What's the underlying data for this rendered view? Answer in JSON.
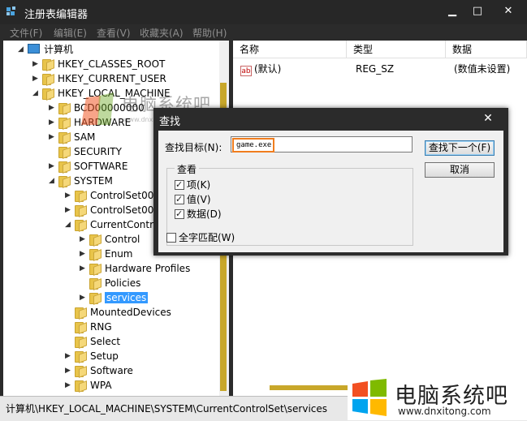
{
  "window": {
    "title": "注册表编辑器",
    "controls": {
      "minimize": "▁",
      "maximize": "□",
      "close": "✕"
    }
  },
  "menu": [
    "文件(F)",
    "编辑(E)",
    "查看(V)",
    "收藏夹(A)",
    "帮助(H)"
  ],
  "tree": {
    "root": "计算机",
    "nodes": [
      {
        "label": "HKEY_CLASSES_ROOT",
        "level": 1,
        "expander": "▶"
      },
      {
        "label": "HKEY_CURRENT_USER",
        "level": 1,
        "expander": "▶"
      },
      {
        "label": "HKEY_LOCAL_MACHINE",
        "level": 1,
        "expander": "◢"
      },
      {
        "label": "BCD00000000",
        "level": 2,
        "expander": "▶"
      },
      {
        "label": "HARDWARE",
        "level": 2,
        "expander": "▶"
      },
      {
        "label": "SAM",
        "level": 2,
        "expander": "▶"
      },
      {
        "label": "SECURITY",
        "level": 2,
        "expander": ""
      },
      {
        "label": "SOFTWARE",
        "level": 2,
        "expander": "▶"
      },
      {
        "label": "SYSTEM",
        "level": 2,
        "expander": "◢"
      },
      {
        "label": "ControlSet001",
        "level": 3,
        "expander": "▶"
      },
      {
        "label": "ControlSet002",
        "level": 3,
        "expander": "▶"
      },
      {
        "label": "CurrentControlSet",
        "level": 3,
        "expander": "◢"
      },
      {
        "label": "Control",
        "level": 4,
        "expander": "▶"
      },
      {
        "label": "Enum",
        "level": 4,
        "expander": "▶"
      },
      {
        "label": "Hardware Profiles",
        "level": 4,
        "expander": "▶"
      },
      {
        "label": "Policies",
        "level": 4,
        "expander": ""
      },
      {
        "label": "services",
        "level": 4,
        "expander": "▶",
        "selected": true
      },
      {
        "label": "MountedDevices",
        "level": 3,
        "expander": ""
      },
      {
        "label": "RNG",
        "level": 3,
        "expander": ""
      },
      {
        "label": "Select",
        "level": 3,
        "expander": ""
      },
      {
        "label": "Setup",
        "level": 3,
        "expander": "▶"
      },
      {
        "label": "Software",
        "level": 3,
        "expander": "▶"
      },
      {
        "label": "WPA",
        "level": 3,
        "expander": "▶"
      }
    ]
  },
  "list": {
    "columns": [
      "名称",
      "类型",
      "数据"
    ],
    "rows": [
      {
        "icon": "ab",
        "name": "(默认)",
        "type": "REG_SZ",
        "data": "(数值未设置)"
      }
    ]
  },
  "status": "计算机\\HKEY_LOCAL_MACHINE\\SYSTEM\\CurrentControlSet\\services",
  "dialog": {
    "title": "查找",
    "close": "✕",
    "find_label": "查找目标(N):",
    "find_value": "game.exe",
    "find_next": "查找下一个(F)",
    "cancel": "取消",
    "look_at_legend": "查看",
    "options": [
      {
        "label": "项(K)",
        "checked": true
      },
      {
        "label": "值(V)",
        "checked": true
      },
      {
        "label": "数据(D)",
        "checked": true
      }
    ],
    "whole_match": {
      "label": "全字匹配(W)",
      "checked": false
    }
  },
  "watermark": {
    "brand": "电脑系统吧",
    "url_small": "www.dnxitong.com",
    "url": "www.dnxitong.com"
  },
  "colors": {
    "title_bg": "#272727",
    "selection": "#3399ff",
    "scroll_thumb": "#c8a72a",
    "highlight_border": "#f07d1e"
  }
}
